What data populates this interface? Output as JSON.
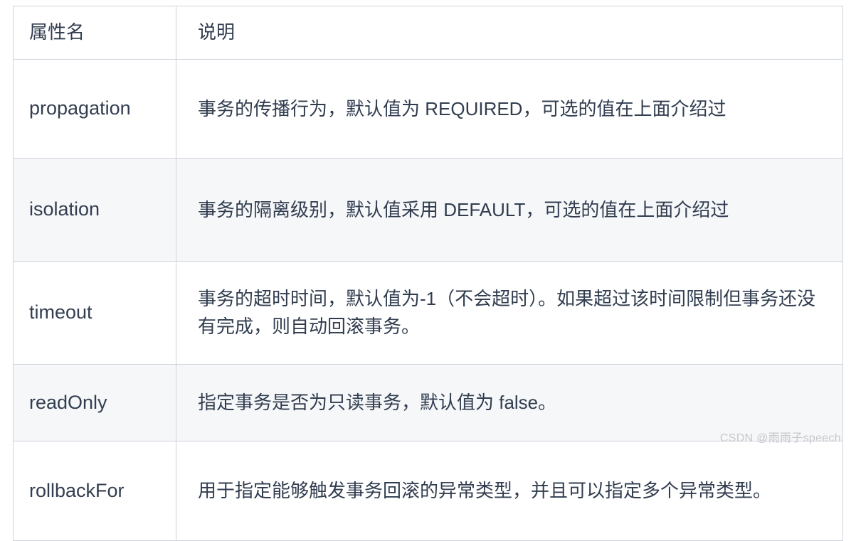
{
  "table": {
    "columns": [
      {
        "key": "name",
        "label": "属性名"
      },
      {
        "key": "desc",
        "label": "说明"
      }
    ],
    "rows": [
      {
        "name": "propagation",
        "desc": "事务的传播行为，默认值为 REQUIRED，可选的值在上面介绍过"
      },
      {
        "name": "isolation",
        "desc": "事务的隔离级别，默认值采用 DEFAULT，可选的值在上面介绍过"
      },
      {
        "name": "timeout",
        "desc": "事务的超时时间，默认值为-1（不会超时）。如果超过该时间限制但事务还没有完成，则自动回滚事务。"
      },
      {
        "name": "readOnly",
        "desc": "指定事务是否为只读事务，默认值为 false。"
      },
      {
        "name": "rollbackFor",
        "desc": "用于指定能够触发事务回滚的异常类型，并且可以指定多个异常类型。"
      }
    ]
  },
  "watermark": {
    "text": "CSDN @雨雨子speech"
  },
  "colors": {
    "text": "#313d4f",
    "border": "#cfd3dc",
    "stripe": "#f6f7f9",
    "background": "#ffffff",
    "watermark": "#c6c8cc"
  }
}
